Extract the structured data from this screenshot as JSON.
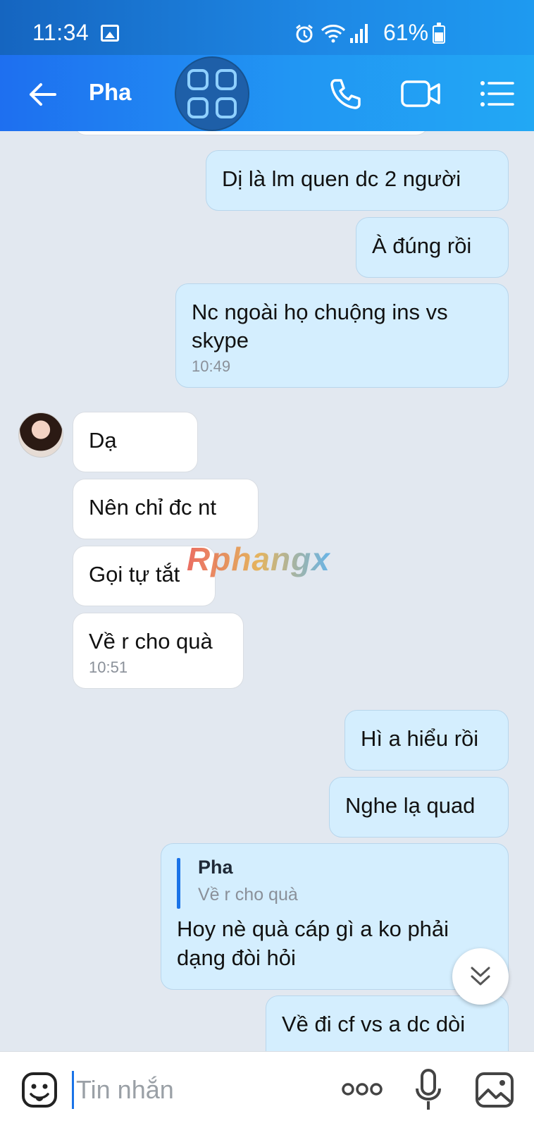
{
  "status_bar": {
    "time": "11:34",
    "battery": "61%"
  },
  "header": {
    "contact_name": "Pha"
  },
  "messages": [
    {
      "side": "out",
      "text": "Dị là lm quen dc 2 người"
    },
    {
      "side": "out",
      "text": "À đúng rồi"
    },
    {
      "side": "out",
      "text": "Nc ngoài họ chuộng ins vs skype",
      "time": "10:49"
    },
    {
      "side": "in",
      "text": "Dạ"
    },
    {
      "side": "in",
      "text": "Nên chỉ đc nt"
    },
    {
      "side": "in",
      "text": "Gọi tự tắt"
    },
    {
      "side": "in",
      "text": "Về r cho quà",
      "time": "10:51"
    },
    {
      "side": "out",
      "text": "Hì a hiểu rồi"
    },
    {
      "side": "out",
      "text": "Nghe lạ quad"
    },
    {
      "side": "out",
      "reply_to_name": "Pha",
      "reply_to_text": "Về r cho quà",
      "text": "Hoy nè quà cáp gì a ko phải dạng đòi hỏi"
    },
    {
      "side": "out",
      "text": "Về đi cf vs a dc dòi"
    }
  ],
  "watermark": "Rphangx",
  "composer": {
    "placeholder": "Tin nhắn"
  },
  "colors": {
    "outgoing_bubble": "#d4eefe",
    "incoming_bubble": "#ffffff",
    "header": "#2196f3",
    "background": "#e2e8f0"
  }
}
